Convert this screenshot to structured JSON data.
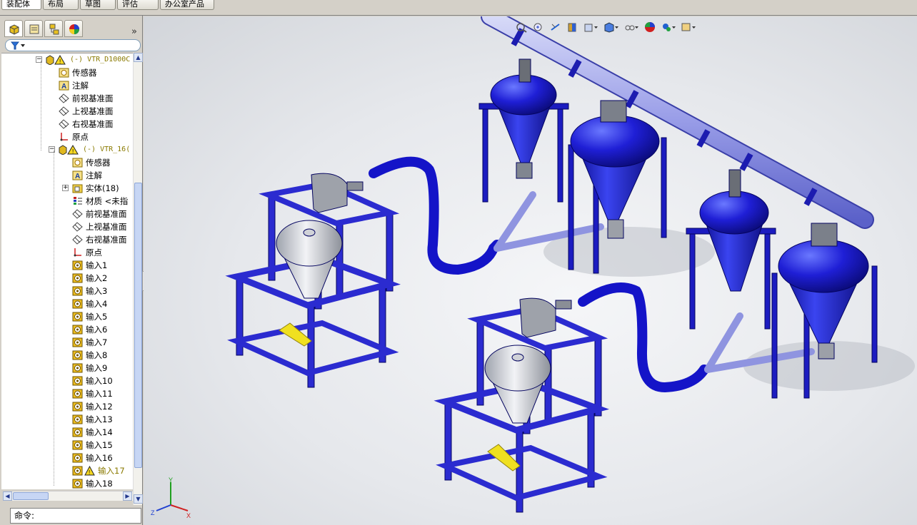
{
  "tabs": [
    {
      "label": "装配体",
      "active": true
    },
    {
      "label": "布局",
      "active": false
    },
    {
      "label": "草图",
      "active": false
    },
    {
      "label": "评估",
      "active": false
    },
    {
      "label": "办公室产品",
      "active": false
    }
  ],
  "panel": {
    "tab_icons": [
      "feature-manager-icon",
      "property-manager-icon",
      "configuration-manager-icon",
      "display-manager-icon"
    ],
    "collapse_glyph": "»",
    "filter_icon": "filter-icon"
  },
  "tree": {
    "root": {
      "label": "(-) VTR_D1000C",
      "icon": "assembly-warning-icon"
    },
    "level1": [
      {
        "label": "传感器",
        "icon": "sensor-icon"
      },
      {
        "label": "注解",
        "icon": "annotation-icon"
      },
      {
        "label": "前视基准面",
        "icon": "plane-icon"
      },
      {
        "label": "上视基准面",
        "icon": "plane-icon"
      },
      {
        "label": "右视基准面",
        "icon": "plane-icon"
      },
      {
        "label": "原点",
        "icon": "origin-icon"
      }
    ],
    "sub": {
      "label": "(-) VTR_16(",
      "icon": "part-warning-icon"
    },
    "level2": [
      {
        "label": "传感器",
        "icon": "sensor-icon"
      },
      {
        "label": "注解",
        "icon": "annotation-icon"
      },
      {
        "label": "实体(18)",
        "icon": "bodies-folder-icon"
      },
      {
        "label": "材质 <未指",
        "icon": "material-icon"
      },
      {
        "label": "前视基准面",
        "icon": "plane-icon"
      },
      {
        "label": "上视基准面",
        "icon": "plane-icon"
      },
      {
        "label": "右视基准面",
        "icon": "plane-icon"
      },
      {
        "label": "原点",
        "icon": "origin-icon"
      },
      {
        "label": "输入1",
        "icon": "import-icon"
      },
      {
        "label": "输入2",
        "icon": "import-icon"
      },
      {
        "label": "输入3",
        "icon": "import-icon"
      },
      {
        "label": "输入4",
        "icon": "import-icon"
      },
      {
        "label": "输入5",
        "icon": "import-icon"
      },
      {
        "label": "输入6",
        "icon": "import-icon"
      },
      {
        "label": "输入7",
        "icon": "import-icon"
      },
      {
        "label": "输入8",
        "icon": "import-icon"
      },
      {
        "label": "输入9",
        "icon": "import-icon"
      },
      {
        "label": "输入10",
        "icon": "import-icon"
      },
      {
        "label": "输入11",
        "icon": "import-icon"
      },
      {
        "label": "输入12",
        "icon": "import-icon"
      },
      {
        "label": "输入13",
        "icon": "import-icon"
      },
      {
        "label": "输入14",
        "icon": "import-icon"
      },
      {
        "label": "输入15",
        "icon": "import-icon"
      },
      {
        "label": "输入16",
        "icon": "import-icon"
      },
      {
        "label": "输入17",
        "icon": "import-warning-icon",
        "warning": true
      },
      {
        "label": "输入18",
        "icon": "import-icon"
      }
    ]
  },
  "command": {
    "label": "命令:"
  },
  "heads_up_toolbar": [
    "zoom-to-fit-icon",
    "zoom-area-icon",
    "previous-view-icon",
    "section-view-icon",
    "view-orientation-icon",
    "display-style-icon",
    "hide-show-items-icon",
    "edit-appearance-icon",
    "apply-scene-icon",
    "view-settings-icon"
  ],
  "triad": {
    "x": "X",
    "y": "Y",
    "z": "Z"
  },
  "colors": {
    "frame_blue": "#2b2bd0",
    "vessel_blue": "#1f1fd6",
    "pipe_lavender": "#9a9ee8",
    "hopper_silver": "#cfd2d8",
    "warning_yellow": "#f0e020"
  }
}
